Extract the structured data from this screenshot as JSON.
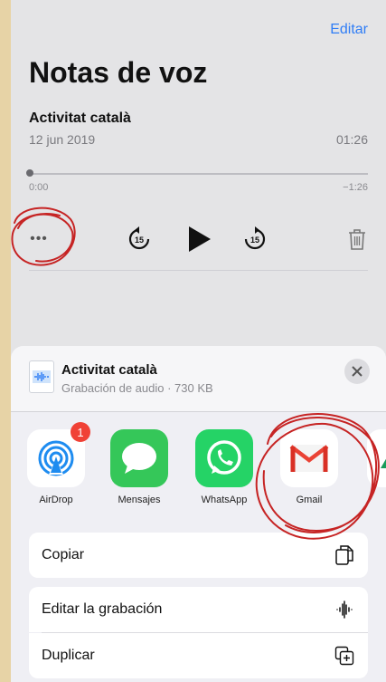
{
  "header": {
    "edit_label": "Editar",
    "title": "Notas de voz"
  },
  "recording": {
    "name": "Activitat català",
    "date": "12 jun 2019",
    "duration": "01:26",
    "time_start": "0:00",
    "time_remaining": "−1:26",
    "progress": 0,
    "more_label": "•••"
  },
  "share_sheet": {
    "file_name": "Activitat català",
    "file_meta": "Grabación de audio · 730 KB",
    "close_icon": "close-icon",
    "apps": [
      {
        "label": "AirDrop",
        "badge": "1",
        "icon": "airdrop-icon",
        "color": "#1e8cf0"
      },
      {
        "label": "Mensajes",
        "icon": "messages-icon",
        "color": "#35c759"
      },
      {
        "label": "WhatsApp",
        "icon": "whatsapp-icon",
        "color": "#25d366"
      },
      {
        "label": "Gmail",
        "icon": "gmail-icon",
        "color": "#ea4335"
      }
    ],
    "actions": [
      {
        "label": "Copiar",
        "icon": "copy-icon"
      },
      {
        "label": "Editar la grabación",
        "icon": "waveform-icon"
      },
      {
        "label": "Duplicar",
        "icon": "duplicate-icon"
      }
    ]
  },
  "colors": {
    "accent": "#2f7df6",
    "annotation": "#c62424",
    "badge": "#f04136"
  }
}
